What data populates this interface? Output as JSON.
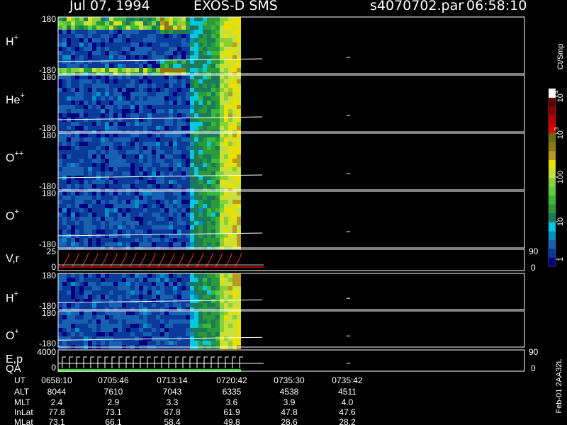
{
  "header": {
    "date": "Jul 07, 1994",
    "instrument": "EXOS-D SMS",
    "file": "s4070702.par",
    "time": "06:58:10"
  },
  "colorbar": {
    "unit": "Ct/Smp",
    "ticks": [
      "1",
      "10",
      "100",
      "10",
      "10"
    ],
    "tick_sup": [
      "",
      "",
      "",
      "3",
      "4"
    ],
    "colors": [
      "#00007f",
      "#0a3a9a",
      "#1860b0",
      "#0090c8",
      "#00c8e0",
      "#1a7a5a",
      "#2a9a3a",
      "#3ab83a",
      "#5ad03a",
      "#8ad03a",
      "#c8e03a",
      "#e8e000",
      "#b89a20",
      "#8a7a10",
      "#6a6a10",
      "#e00000",
      "#c00000",
      "#8a0000",
      "#600000",
      "#ffffff"
    ]
  },
  "panels": [
    {
      "label": "H",
      "sup": "+",
      "ymax": "180",
      "ymin": "-180"
    },
    {
      "label": "He",
      "sup": "+",
      "ymax": "180",
      "ymin": "-180"
    },
    {
      "label": "O",
      "sup": "++",
      "ymax": "180",
      "ymin": "-180"
    },
    {
      "label": "O",
      "sup": "+",
      "ymax": "180",
      "ymin": "-180"
    },
    {
      "label": "V,r",
      "sup": "",
      "ymax": "25",
      "ymin": "0",
      "right_max": "90",
      "right_min": "0"
    },
    {
      "label": "H",
      "sup": "+",
      "ymax": "180",
      "ymin": "-180"
    },
    {
      "label": "O",
      "sup": "+",
      "ymax": "180",
      "ymin": "-180"
    },
    {
      "label": "E,p",
      "sup": "",
      "label2": "QA",
      "ymax": "4000",
      "ymin": "0",
      "right_max": "90",
      "right_min": "0"
    }
  ],
  "footer": {
    "row_labels": [
      "UT",
      "ALT",
      "MLT",
      "InLat",
      "MLat"
    ],
    "columns": [
      {
        "UT": "0658:10",
        "ALT": "8044",
        "MLT": "2.4",
        "InLat": "77.8",
        "MLat": "73.1"
      },
      {
        "UT": "0705:46",
        "ALT": "7610",
        "MLT": "2.9",
        "InLat": "73.1",
        "MLat": "66.1"
      },
      {
        "UT": "0713:14",
        "ALT": "7043",
        "MLT": "3.3",
        "InLat": "67.8",
        "MLat": "58.4"
      },
      {
        "UT": "0720:42",
        "ALT": "6335",
        "MLT": "3.6",
        "InLat": "61.9",
        "MLat": "49.8"
      },
      {
        "UT": "0735:30",
        "ALT": "4538",
        "MLT": "3.9",
        "InLat": "47.8",
        "MLat": "28.6"
      },
      {
        "UT": "0735:42",
        "ALT": "4511",
        "MLT": "4.0",
        "InLat": "47.6",
        "MLat": "28.2"
      }
    ],
    "side_note": "Feb-01 2AA32L"
  },
  "chart_data": {
    "type": "heatmap",
    "title": "Jul 07, 1994   EXOS-D SMS",
    "xlabel": "UT",
    "x_ticks": [
      "0658:10",
      "0705:46",
      "0713:14",
      "0720:42",
      "0735:30",
      "0735:42"
    ],
    "colorscale": "log",
    "colorscale_unit": "Ct/Smp",
    "colorscale_range": [
      1,
      10000
    ],
    "panels": [
      "H+",
      "He+",
      "O++",
      "O+",
      "V,r",
      "H+",
      "O+",
      "E,p / QA"
    ],
    "pitch_angle_range": [
      -180,
      180
    ],
    "note": "spectrogram counts shown up to ~0721 UT, no data afterwards"
  }
}
